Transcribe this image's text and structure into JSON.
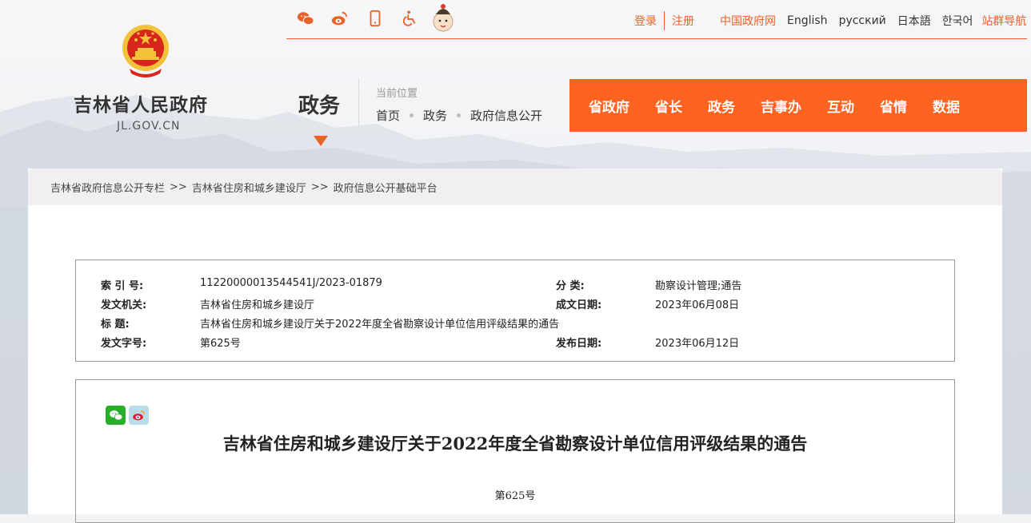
{
  "header": {
    "site_name": "吉林省人民政府",
    "site_domain": "JL.GOV.CN",
    "top_icons": [
      "wechat-icon",
      "weibo-icon",
      "mobile-icon",
      "accessibility-icon",
      "mascot-icon"
    ],
    "login": "登录",
    "register": "注册",
    "gov_link": "中国政府网",
    "lang_en": "English",
    "lang_ru": "русский",
    "lang_ja": "日本語",
    "lang_ko": "한국어",
    "site_nav": "站群导航",
    "channel": "政务",
    "location_label": "当前位置",
    "location_crumbs": [
      "首页",
      "政务",
      "政府信息公开"
    ]
  },
  "main_nav": [
    "省政府",
    "省长",
    "政务",
    "吉事办",
    "互动",
    "省情",
    "数据"
  ],
  "breadcrumb": [
    "吉林省政府信息公开专栏",
    "吉林省住房和城乡建设厅",
    "政府信息公开基础平台"
  ],
  "breadcrumb_sep": ">>",
  "meta": {
    "index_label": "索 引 号:",
    "index_value": "11220000013544541J/2023-01879",
    "category_label": "分  类:",
    "category_value": "勘察设计管理;通告",
    "issuer_label": "发文机关:",
    "issuer_value": "吉林省住房和城乡建设厅",
    "date_label": "成文日期:",
    "date_value": "2023年06月08日",
    "title_label": "标    题:",
    "title_value": "吉林省住房和城乡建设厅关于2022年度全省勘察设计单位信用评级结果的通告",
    "docno_label": "发文字号:",
    "docno_value": "第625号",
    "publish_label": "发布日期:",
    "publish_value": "2023年06月12日"
  },
  "document": {
    "title": "吉林省住房和城乡建设厅关于2022年度全省勘察设计单位信用评级结果的通告",
    "number": "第625号"
  },
  "colors": {
    "accent": "#ff6321",
    "top_link": "#e9622a",
    "wechat": "#2aae29"
  }
}
